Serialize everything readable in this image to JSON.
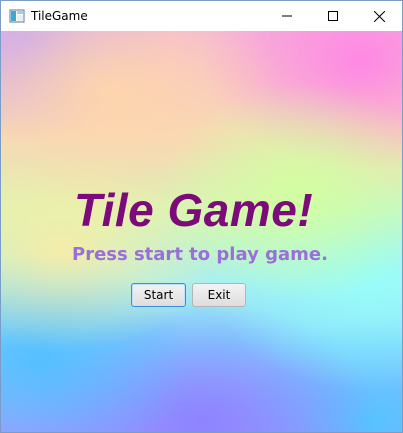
{
  "window": {
    "title": "TileGame",
    "icon": "java-app-icon",
    "controls": [
      "minimize-icon",
      "maximize-icon",
      "close-icon"
    ]
  },
  "main": {
    "heading": "Tile Game!",
    "subtitle": "Press start to play game.",
    "start_label": "Start",
    "exit_label": "Exit"
  },
  "colors": {
    "heading": "#7b0b7a",
    "subtitle": "#9a6fd8",
    "focus_border": "#3a8edb"
  }
}
